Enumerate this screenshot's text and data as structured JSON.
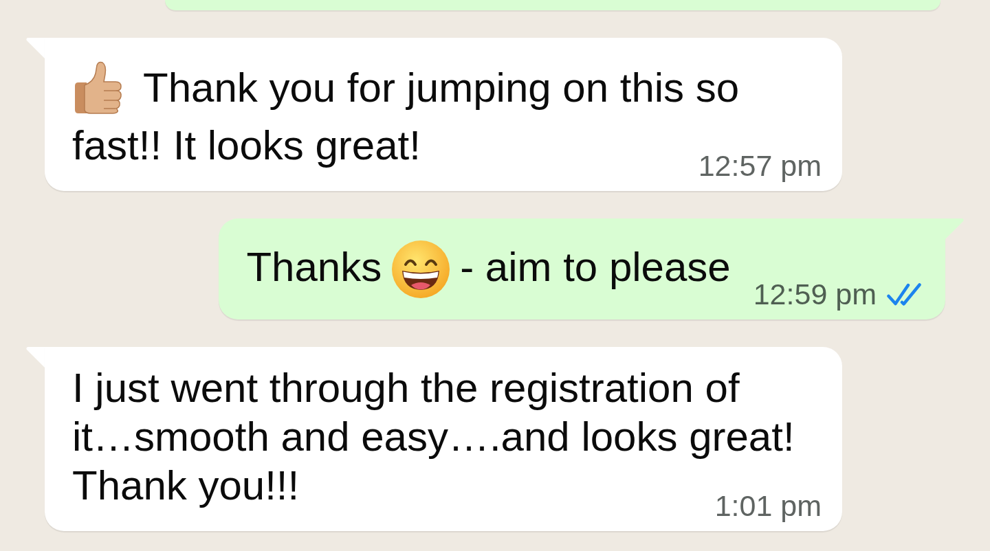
{
  "chat": {
    "cut_off_message": {
      "kind": "outgoing"
    },
    "messages": [
      {
        "kind": "incoming",
        "lines": [
          [
            {
              "kind": "thumbs_up"
            },
            {
              "kind": "text",
              "text": "Thank you for jumping on this so"
            }
          ],
          [
            {
              "kind": "text",
              "text": "fast!! It looks great!"
            }
          ]
        ],
        "time": "12:57 pm"
      },
      {
        "kind": "outgoing",
        "lines": [
          [
            {
              "kind": "text",
              "text": "Thanks"
            },
            {
              "kind": "grin"
            },
            {
              "kind": "text",
              "text": "- aim to please"
            }
          ]
        ],
        "time": "12:59 pm",
        "read": true
      },
      {
        "kind": "incoming",
        "lines": [
          [
            {
              "kind": "text",
              "text": "I just went through the registration of"
            }
          ],
          [
            {
              "kind": "text",
              "text": "it…smooth and easy….and looks great!"
            }
          ],
          [
            {
              "kind": "text",
              "text": "Thank you!!!"
            }
          ]
        ],
        "time": "1:01 pm"
      }
    ]
  }
}
